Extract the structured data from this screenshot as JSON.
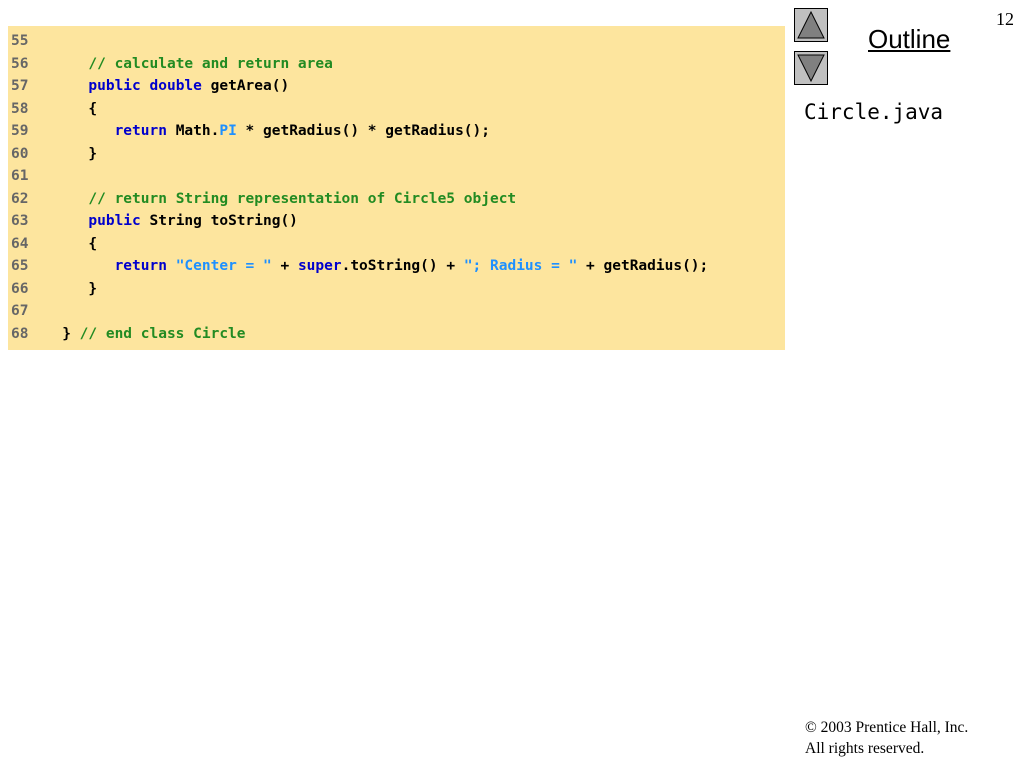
{
  "slide": {
    "page_number": "12",
    "outline_label": "Outline",
    "filename": "Circle.java",
    "copyright_line1": "© 2003 Prentice Hall, Inc.",
    "copyright_line2": "All rights reserved."
  },
  "code": {
    "lines": [
      {
        "num": "55",
        "segments": []
      },
      {
        "num": "56",
        "segments": [
          {
            "t": "      "
          },
          {
            "t": "// calculate and return area",
            "c": "cm"
          }
        ]
      },
      {
        "num": "57",
        "segments": [
          {
            "t": "      "
          },
          {
            "t": "public",
            "c": "kw"
          },
          {
            "t": " "
          },
          {
            "t": "double",
            "c": "kw"
          },
          {
            "t": " getArea()"
          }
        ]
      },
      {
        "num": "58",
        "segments": [
          {
            "t": "      {"
          }
        ]
      },
      {
        "num": "59",
        "segments": [
          {
            "t": "         "
          },
          {
            "t": "return",
            "c": "kw"
          },
          {
            "t": " Math."
          },
          {
            "t": "PI",
            "c": "fd"
          },
          {
            "t": " * getRadius() * getRadius();"
          }
        ]
      },
      {
        "num": "60",
        "segments": [
          {
            "t": "      }"
          }
        ]
      },
      {
        "num": "61",
        "segments": []
      },
      {
        "num": "62",
        "segments": [
          {
            "t": "      "
          },
          {
            "t": "// return String representation of Circle5 object",
            "c": "cm"
          }
        ]
      },
      {
        "num": "63",
        "segments": [
          {
            "t": "      "
          },
          {
            "t": "public",
            "c": "kw"
          },
          {
            "t": " String toString()"
          }
        ]
      },
      {
        "num": "64",
        "segments": [
          {
            "t": "      {"
          }
        ]
      },
      {
        "num": "65",
        "segments": [
          {
            "t": "         "
          },
          {
            "t": "return",
            "c": "kw"
          },
          {
            "t": " "
          },
          {
            "t": "\"Center = \"",
            "c": "st"
          },
          {
            "t": " + "
          },
          {
            "t": "super",
            "c": "kw"
          },
          {
            "t": ".toString() + "
          },
          {
            "t": "\"; Radius = \"",
            "c": "st"
          },
          {
            "t": " + getRadius();"
          }
        ]
      },
      {
        "num": "66",
        "segments": [
          {
            "t": "      }"
          }
        ]
      },
      {
        "num": "67",
        "segments": []
      },
      {
        "num": "68",
        "segments": [
          {
            "t": "   } "
          },
          {
            "t": "// end class Circle",
            "c": "cm"
          }
        ]
      }
    ]
  },
  "icons": {
    "nav_up": "triangle-up-icon",
    "nav_down": "triangle-down-icon"
  }
}
